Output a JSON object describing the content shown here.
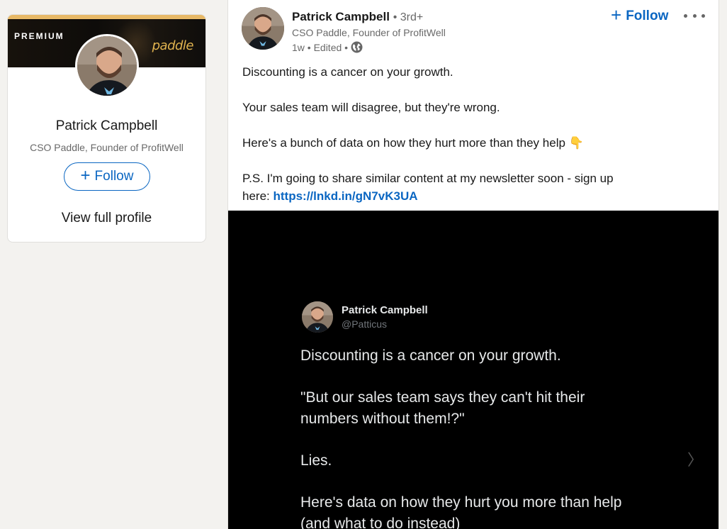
{
  "profile_card": {
    "premium_label": "PREMIUM",
    "banner_logo": "paddle",
    "name": "Patrick Campbell",
    "headline": "CSO Paddle, Founder of ProfitWell",
    "follow_label": "Follow",
    "view_profile_label": "View full profile"
  },
  "post": {
    "actor_name": "Patrick Campbell",
    "actor_degree": "• 3rd+",
    "actor_headline": "CSO Paddle, Founder of ProfitWell",
    "actor_meta": "1w • Edited •",
    "follow_label": "Follow",
    "text": {
      "line1": "Discounting is a cancer on your growth.",
      "line2": "Your sales team will disagree, but they're wrong.",
      "line3": "Here's a bunch of data on how they hurt more than they help 👇",
      "line4": "P.S. I'm going to share similar content at my newsletter soon - sign up",
      "line5_prefix": "here: ",
      "link": "https://lnkd.in/gN7vK3UA"
    }
  },
  "media": {
    "tweet_name": "Patrick Campbell",
    "tweet_handle": "@Patticus",
    "body": {
      "p1": "Discounting is a cancer on your growth.",
      "p2": "\"But our sales team says they can't hit their numbers without them!?\"",
      "p3": "Lies.",
      "p4": "Here's data on how they hurt you more than help (and what to do instead)"
    },
    "next_glyph": "〉"
  },
  "colors": {
    "accent": "#0a66c2",
    "page_bg": "#f3f2ef",
    "premium": "#e7b967",
    "media_bg": "#000000"
  },
  "icons": [
    "globe-icon",
    "more-icon",
    "plus-icon",
    "chevron-right-icon"
  ]
}
